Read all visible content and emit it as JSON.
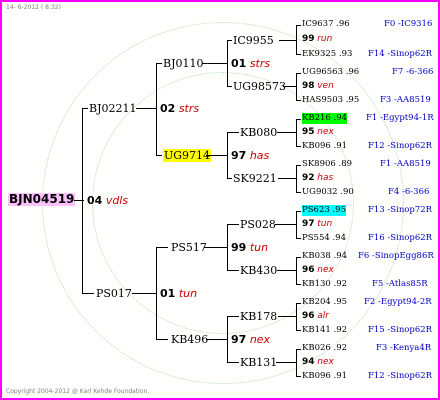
{
  "date": "14- 6-2012 ( 8:32)",
  "copyright": "Copyright 2004-2012 @ Karl Kehde Foundation.",
  "highlight_colors": {
    "root": "#ffc0ff",
    "yellow": "#ffff00",
    "green": "#00ff00",
    "cyan": "#00ffff"
  },
  "root": {
    "id": "BJN04519",
    "num": "04",
    "kw": "vdls"
  },
  "gen1": [
    {
      "id": "BJ02211",
      "num": "02",
      "kw": "strs"
    },
    {
      "id": "PS017",
      "num": "01",
      "kw": "tun"
    }
  ],
  "gen2": [
    {
      "id": "BJ0110",
      "num": "01",
      "kw": "strs"
    },
    {
      "id": "UG9714",
      "num": "97",
      "kw": "has"
    },
    {
      "id": "PS517",
      "num": "99",
      "kw": "tun"
    },
    {
      "id": "KB496",
      "num": "97",
      "kw": "nex"
    }
  ],
  "gen3": [
    {
      "id": "IC9955"
    },
    {
      "id": "UG98573"
    },
    {
      "id": "KB080"
    },
    {
      "id": "SK9221"
    },
    {
      "id": "PS028"
    },
    {
      "id": "KB430"
    },
    {
      "id": "KB178"
    },
    {
      "id": "KB131"
    }
  ],
  "gen4": [
    {
      "top": "IC9637 .96",
      "top_src": "F0 -IC9316",
      "num": "99",
      "kw": "run",
      "bot": "EK9325 .93",
      "bot_src": "F14 -Sinop62R"
    },
    {
      "top": "UG96563 .96",
      "top_src": "F7 -6-366",
      "num": "98",
      "kw": "ven",
      "bot": "HAS9503 .95",
      "bot_src": "F3 -AA8519"
    },
    {
      "top": "KB216 .94",
      "top_src": "F1 -Egypt94-1R",
      "num": "95",
      "kw": "nex",
      "bot": "KB096 .91",
      "bot_src": "F12 -Sinop62R"
    },
    {
      "top": "SK8906 .89",
      "top_src": "F1 -AA8519",
      "num": "92",
      "kw": "has",
      "bot": "UG9032 .90",
      "bot_src": "F4 -6-366"
    },
    {
      "top": "PS623 .95",
      "top_src": "F13 -Sinop72R",
      "num": "97",
      "kw": "tun",
      "bot": "PS554 .94",
      "bot_src": "F16 -Sinop62R"
    },
    {
      "top": "KB038 .94",
      "top_src": "F6 -SinopEgg86R",
      "num": "96",
      "kw": "nex",
      "bot": "KB130 .92",
      "bot_src": "F5 -Atlas85R"
    },
    {
      "top": "KB204 .95",
      "top_src": "F2 -Egypt94-2R",
      "num": "96",
      "kw": "alr",
      "bot": "KB141 .92",
      "bot_src": "F15 -Sinop62R"
    },
    {
      "top": "KB026 .92",
      "top_src": "F3 -Kenya4R",
      "num": "94",
      "kw": "nex",
      "bot": "KB096 .91",
      "bot_src": "F12 -Sinop62R"
    }
  ]
}
